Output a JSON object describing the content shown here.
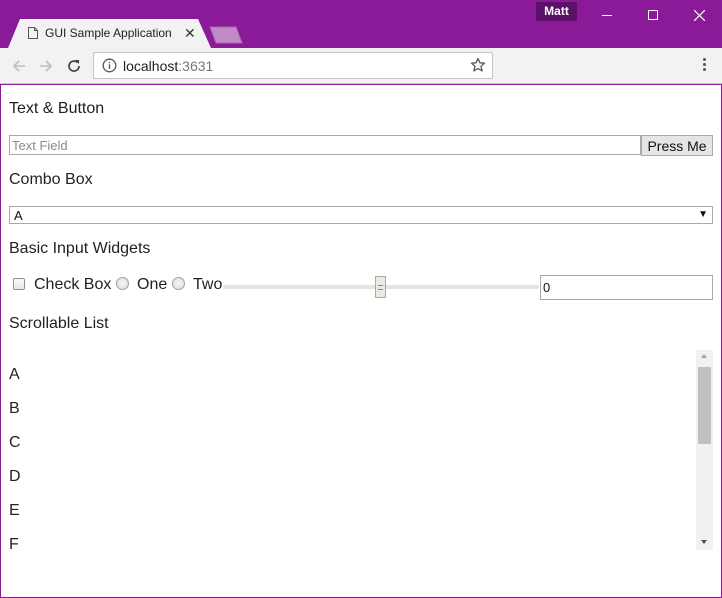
{
  "window": {
    "profile_name": "Matt",
    "accent_color": "#8a1a98",
    "icons": [
      "minimize-icon",
      "maximize-icon",
      "close-icon"
    ]
  },
  "tab": {
    "title": "GUI Sample Application",
    "icon": "document-icon",
    "close_glyph": "✕"
  },
  "toolbar": {
    "url_host": "localhost",
    "url_port": ":3631",
    "icons": [
      "back-arrow-icon",
      "forward-arrow-icon",
      "reload-icon",
      "info-icon",
      "star-icon",
      "menu-dots-icon"
    ]
  },
  "sections": {
    "text_button": {
      "heading": "Text & Button",
      "text_field_placeholder": "Text Field",
      "text_field_value": "",
      "button_label": "Press Me"
    },
    "combo_box": {
      "heading": "Combo Box",
      "selected_value": "A",
      "arrow_glyph": "▼"
    },
    "basic_input": {
      "heading": "Basic Input Widgets",
      "checkbox_label": "Check Box",
      "checkbox_checked": false,
      "radio_one_label": "One",
      "radio_two_label": "Two",
      "number_value": "0"
    },
    "scrollable_list": {
      "heading": "Scrollable List",
      "items": [
        "A",
        "B",
        "C",
        "D",
        "E",
        "F"
      ]
    }
  }
}
